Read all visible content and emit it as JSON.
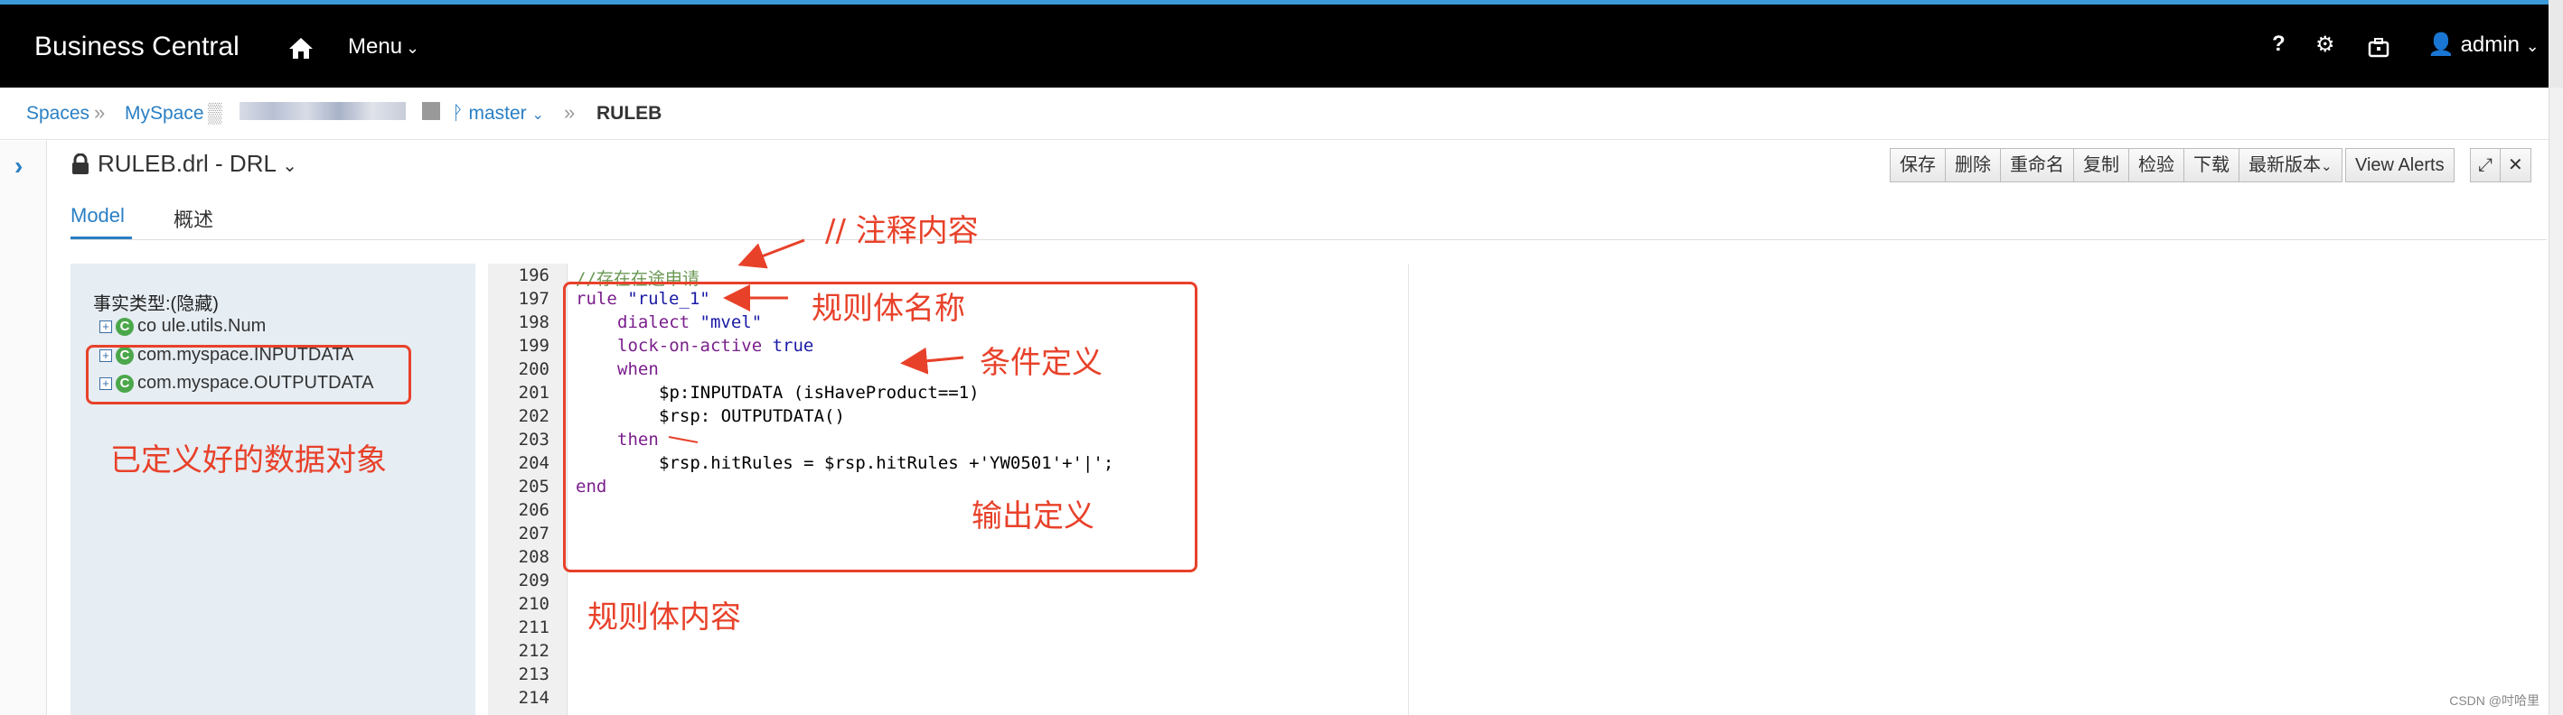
{
  "navbar": {
    "brand": "Business Central",
    "menu_label": "Menu",
    "help_label": "?",
    "user_label": "admin"
  },
  "breadcrumb": {
    "spaces": "Spaces",
    "space": "MySpace",
    "branch": "master",
    "current": "RULEB"
  },
  "editor": {
    "title": "RULEB.drl - DRL",
    "toolbar": [
      "保存",
      "删除",
      "重命名",
      "复制",
      "检验",
      "下载",
      "最新版本",
      "View Alerts"
    ],
    "tabs": [
      "Model",
      "概述"
    ]
  },
  "fact_panel": {
    "label": "事实类型:(隐藏)",
    "items": [
      "co          ule.utils.Num",
      "com.myspace.INPUTDATA",
      "com.myspace.OUTPUTDATA"
    ]
  },
  "code": {
    "line_numbers": [
      "196",
      "197",
      "198",
      "199",
      "200",
      "201",
      "202",
      "203",
      "204",
      "205",
      "206",
      "207",
      "208",
      "209",
      "210",
      "211",
      "212",
      "213",
      "214"
    ],
    "comment_line": "//存在在途申请",
    "rule_kw": "rule",
    "rule_name": "\"rule_1\"",
    "dialect_kw": "dialect",
    "dialect_val": "\"mvel\"",
    "lock_kw": "lock-on-active",
    "lock_val": "true",
    "when_kw": "when",
    "cond1": "$p:INPUTDATA (isHaveProduct==1)",
    "cond2": "$rsp: OUTPUTDATA()",
    "then_kw": "then",
    "action": "$rsp.hitRules = $rsp.hitRules +'YW0501'+'|';",
    "end_kw": "end"
  },
  "annotations": {
    "comment": "// 注释内容",
    "rule_name": "规则体名称",
    "condition": "条件定义",
    "output": "输出定义",
    "rule_body": "规则体内容",
    "data_objects": "已定义好的数据对象"
  },
  "watermark": "CSDN @吋哈里",
  "colors": {
    "accent": "#2a7fc4",
    "annotation": "#e8412a",
    "navbar": "#000000"
  }
}
